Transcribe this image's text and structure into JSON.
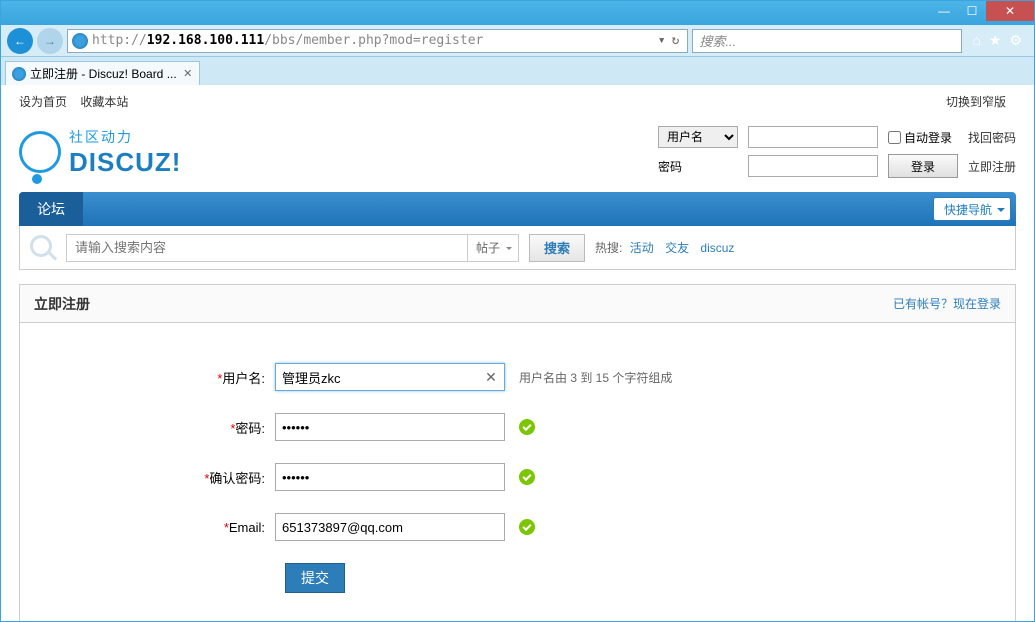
{
  "browser": {
    "url_protocol": "http://",
    "url_host": "192.168.100.111",
    "url_path": "/bbs/member.php?mod=register",
    "search_placeholder": "搜索...",
    "tab_title": "立即注册 - Discuz! Board ..."
  },
  "toplinks": {
    "set_home": "设为首页",
    "favorite": "收藏本站",
    "narrow": "切换到窄版"
  },
  "logo": {
    "cn": "社区动力",
    "en": "DISCUZ!"
  },
  "login": {
    "field_user": "用户名",
    "field_pass": "密码",
    "auto_login": "自动登录",
    "find_pass": "找回密码",
    "login_btn": "登录",
    "register_now": "立即注册"
  },
  "nav": {
    "forum": "论坛",
    "quick": "快捷导航"
  },
  "search": {
    "placeholder": "请输入搜索内容",
    "type": "帖子",
    "btn": "搜索",
    "hot_label": "热搜:",
    "hot1": "活动",
    "hot2": "交友",
    "hot3": "discuz"
  },
  "register": {
    "title": "立即注册",
    "have_account": "已有帐号？现在登录",
    "username_label": "用户名:",
    "username_value": "管理员zkc",
    "username_hint": "用户名由 3 到 15 个字符组成",
    "password_label": "密码:",
    "password_value": "••••••",
    "password2_label": "确认密码:",
    "password2_value": "••••••",
    "email_label": "Email:",
    "email_value": "651373897@qq.com",
    "submit": "提交"
  }
}
